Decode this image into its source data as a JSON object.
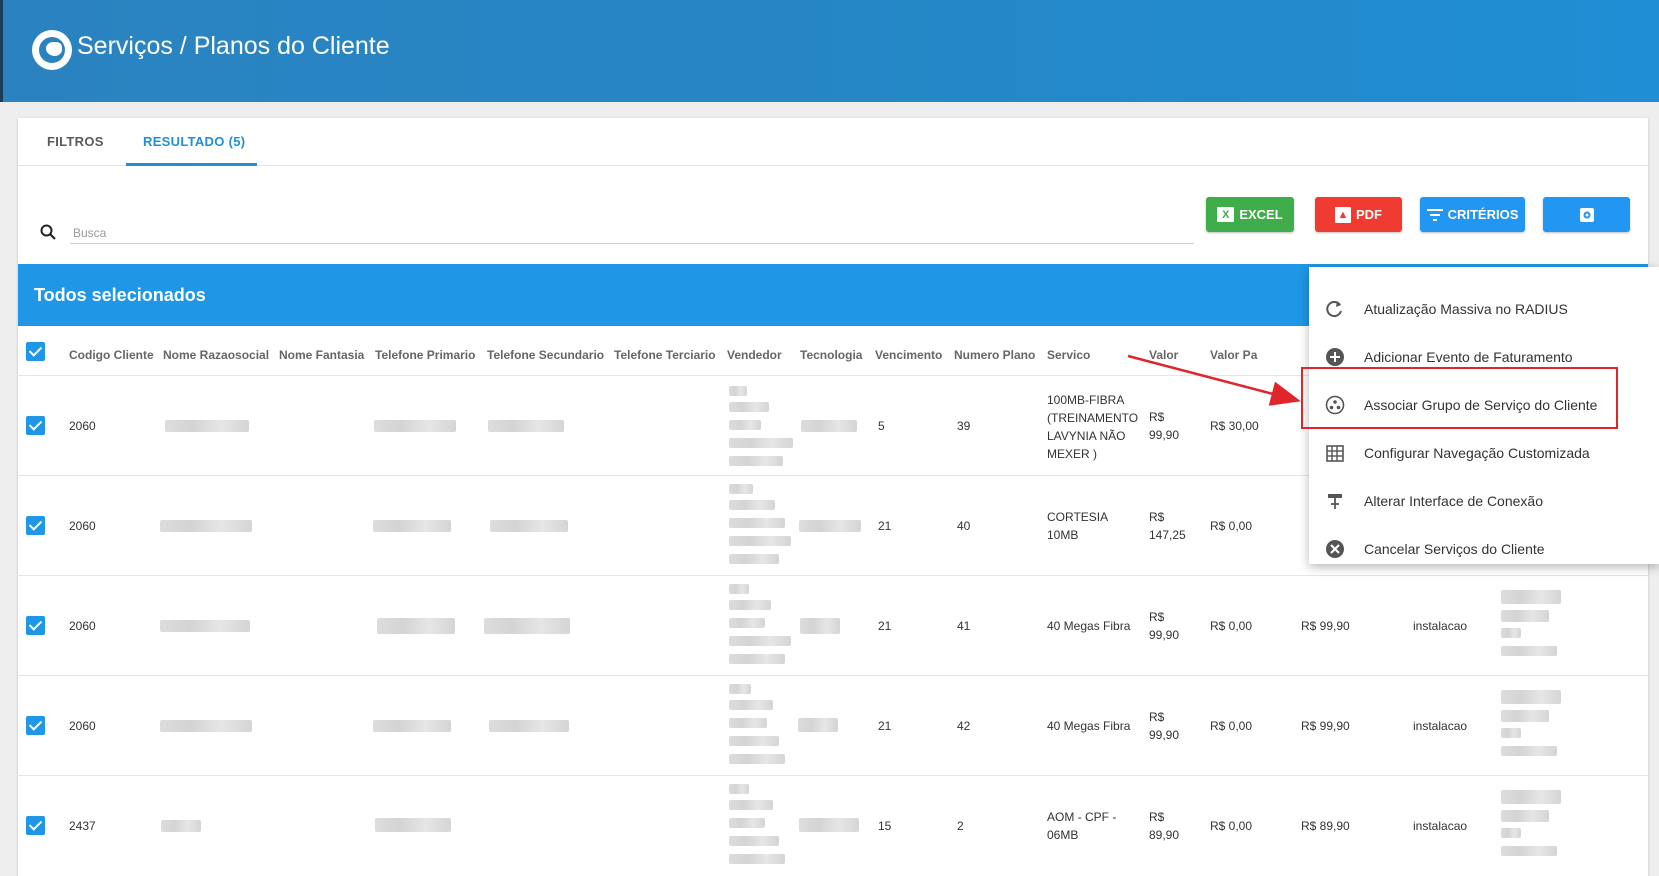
{
  "header": {
    "title": "Serviços / Planos do Cliente",
    "logo_icon": "globe-icon"
  },
  "tabs": [
    {
      "label": "FILTROS"
    },
    {
      "label": "RESULTADO (5)",
      "active": true
    }
  ],
  "search": {
    "placeholder": "Busca",
    "value": ""
  },
  "toolbar": {
    "excel_label": "EXCEL",
    "pdf_label": "PDF",
    "criterios_label": "CRITÉRIOS",
    "settings_icon": "gear-icon"
  },
  "selection_bar": {
    "label": "Todos selecionados"
  },
  "table": {
    "columns": [
      "Codigo Cliente",
      "Nome Razaosocial",
      "Nome Fantasia",
      "Telefone Primario",
      "Telefone Secundario",
      "Telefone Terciario",
      "Vendedor",
      "Tecnologia",
      "Vencimento",
      "Numero Plano",
      "Servico",
      "Valor",
      "Valor Pa"
    ],
    "rows": [
      {
        "codigo": "2060",
        "vencimento": "5",
        "plano": "39",
        "servico": "100MB-FIBRA (TREINAMENTO LAVYNIA NÃO MEXER )",
        "valor": "R$ 99,90",
        "valor_pa": "R$ 30,00",
        "total": "",
        "tipo": ""
      },
      {
        "codigo": "2060",
        "vencimento": "21",
        "plano": "40",
        "servico": "CORTESIA 10MB",
        "valor": "R$ 147,25",
        "valor_pa": "R$ 0,00",
        "total": "",
        "tipo": ""
      },
      {
        "codigo": "2060",
        "vencimento": "21",
        "plano": "41",
        "servico": "40 Megas Fibra",
        "valor": "R$ 99,90",
        "valor_pa": "R$ 0,00",
        "total": "R$ 99,90",
        "tipo": "instalacao"
      },
      {
        "codigo": "2060",
        "vencimento": "21",
        "plano": "42",
        "servico": "40 Megas Fibra",
        "valor": "R$ 99,90",
        "valor_pa": "R$ 0,00",
        "total": "R$ 99,90",
        "tipo": "instalacao"
      },
      {
        "codigo": "2437",
        "vencimento": "15",
        "plano": "2",
        "servico": "AOM - CPF - 06MB",
        "valor": "R$ 89,90",
        "valor_pa": "R$ 0,00",
        "total": "R$ 89,90",
        "tipo": "instalacao"
      }
    ]
  },
  "context_menu": {
    "items": [
      {
        "label": "Atualização Massiva no RADIUS",
        "icon": "refresh-icon"
      },
      {
        "label": "Adicionar Evento de Faturamento",
        "icon": "add-circle-icon"
      },
      {
        "label": "Associar Grupo de Serviço do Cliente",
        "icon": "group-icon",
        "highlighted": true
      },
      {
        "label": "Configurar Navegação Customizada",
        "icon": "grid-icon"
      },
      {
        "label": "Alterar Interface de Conexão",
        "icon": "network-icon"
      },
      {
        "label": "Cancelar Serviços do Cliente",
        "icon": "cancel-icon"
      }
    ]
  },
  "colors": {
    "accent": "#1f97e6",
    "excel": "#3fae4a",
    "pdf": "#ef3b32",
    "header": "#2a83c0",
    "highlight": "#e0262b"
  }
}
